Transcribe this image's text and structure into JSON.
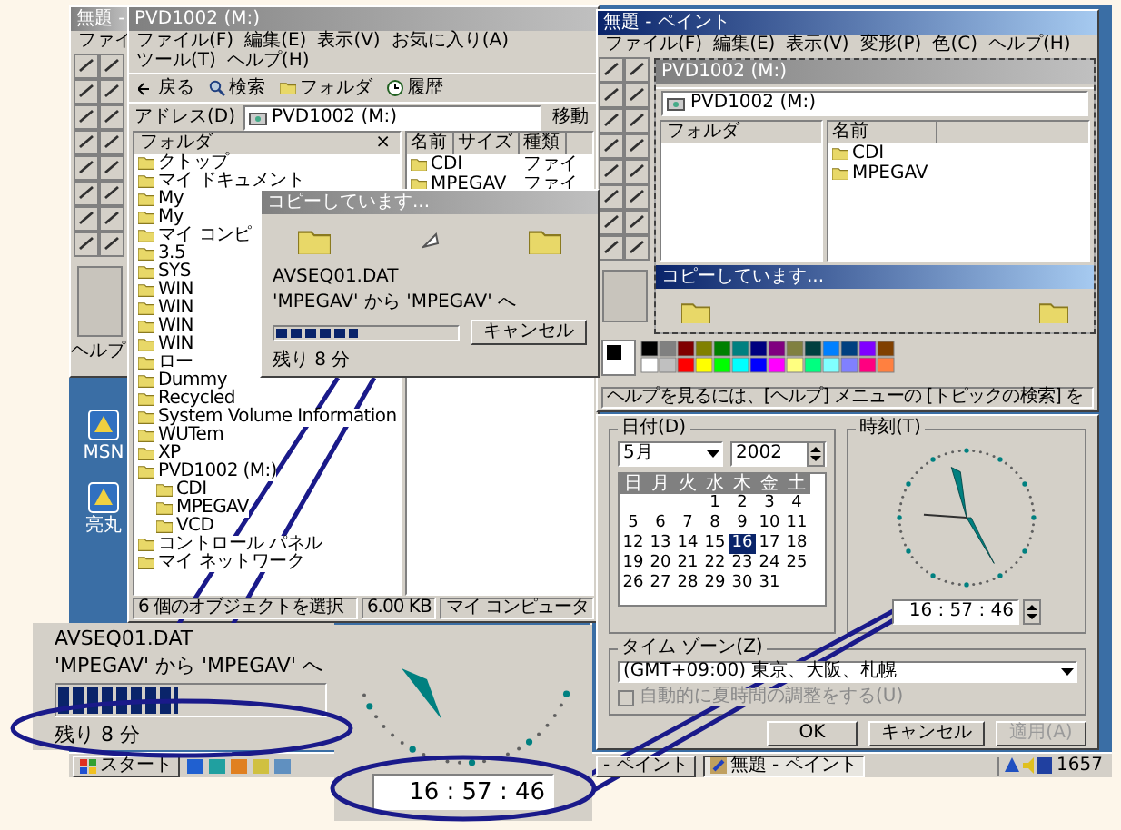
{
  "left_screen": {
    "paint": {
      "title": "無題 -",
      "active": false,
      "menu": "ファイ",
      "status": "ヘルプ"
    },
    "desktop_icons": [
      "MSN",
      "亮丸"
    ],
    "explorer": {
      "title": "PVD1002 (M:)",
      "active": false,
      "menu": [
        "ファイル(F)",
        "編集(E)",
        "表示(V)",
        "お気に入り(A)",
        "ツール(T)",
        "ヘルプ(H)"
      ],
      "toolbar": [
        "戻る",
        "検索",
        "フォルダ",
        "履歴"
      ],
      "address_label": "アドレス(D)",
      "address": "PVD1002 (M:)",
      "go": "移動",
      "folders_title": "フォルダ",
      "folders_close": "×",
      "tree": [
        {
          "label": "クトップ"
        },
        {
          "label": "マイ ドキュメント"
        },
        {
          "label": "My"
        },
        {
          "label": "My"
        },
        {
          "label": "マイ コンピ"
        },
        {
          "label": "3.5"
        },
        {
          "label": "SYS"
        },
        {
          "label": "WIN"
        },
        {
          "label": "WIN"
        },
        {
          "label": "WIN"
        },
        {
          "label": "WIN"
        },
        {
          "label": "ロー"
        },
        {
          "label": "Dummy"
        },
        {
          "label": "Recycled"
        },
        {
          "label": "System Volume Information"
        },
        {
          "label": "WUTem"
        },
        {
          "label": "XP"
        },
        {
          "label": "PVD1002 (M:)",
          "children": [
            {
              "label": "CDI"
            },
            {
              "label": "MPEGAV"
            },
            {
              "label": "VCD"
            }
          ]
        },
        {
          "label": "コントロール パネル"
        },
        {
          "label": "マイ ネットワーク"
        }
      ],
      "columns": [
        "名前",
        "サイズ",
        "種類"
      ],
      "files": [
        {
          "name": "CDI",
          "type": "ファイ"
        },
        {
          "name": "MPEGAV",
          "type": "ファイ"
        }
      ],
      "status": [
        "6 個のオブジェクトを選択",
        "6.00 KB",
        "マイ コンピュータ"
      ]
    },
    "copy_dialog": {
      "title": "コピーしています...",
      "active": false,
      "file": "AVSEQ01.DAT",
      "from_to": "'MPEGAV' から 'MPEGAV' へ",
      "level": 0.45,
      "remaining": "残り 8 分",
      "cancel": "キャンセル"
    },
    "taskbar": {
      "start": "スタート"
    }
  },
  "right_screen": {
    "paint": {
      "title": "無題 - ペイント",
      "active": true,
      "menu": [
        "ファイル(F)",
        "編集(E)",
        "表示(V)",
        "変形(P)",
        "色(C)",
        "ヘルプ(H)"
      ],
      "nested": {
        "title": "PVD1002 (M:)",
        "address": "PVD1002 (M:)",
        "folders_title": "フォルダ",
        "column": "名前",
        "files": [
          "CDI",
          "MPEGAV"
        ],
        "dialog_title": "コピーしています...",
        "dialog_active": true
      },
      "status": "ヘルプを見るには、[ヘルプ] メニューの [トピックの検索] を"
    },
    "datetime": {
      "date_group": "日付(D)",
      "month": "5月",
      "year": "2002",
      "weekdays": [
        "日",
        "月",
        "火",
        "水",
        "木",
        "金",
        "土"
      ],
      "weeks": [
        [
          {
            "d": "1",
            "selected": false
          },
          {
            "d": "2",
            "selected": false
          },
          {
            "d": "3",
            "selected": false
          },
          {
            "d": "4",
            "selected": false
          }
        ],
        [
          {
            "d": "5",
            "selected": false
          },
          {
            "d": "6",
            "selected": false
          },
          {
            "d": "7",
            "selected": false
          },
          {
            "d": "8",
            "selected": false
          },
          {
            "d": "9",
            "selected": false
          },
          {
            "d": "10",
            "selected": false
          },
          {
            "d": "11",
            "selected": false
          }
        ],
        [
          {
            "d": "12",
            "selected": false
          },
          {
            "d": "13",
            "selected": false
          },
          {
            "d": "14",
            "selected": false
          },
          {
            "d": "15",
            "selected": false
          },
          {
            "d": "16",
            "selected": true
          },
          {
            "d": "17",
            "selected": false
          },
          {
            "d": "18",
            "selected": false
          }
        ],
        [
          {
            "d": "19",
            "selected": false
          },
          {
            "d": "20",
            "selected": false
          },
          {
            "d": "21",
            "selected": false
          },
          {
            "d": "22",
            "selected": false
          },
          {
            "d": "23",
            "selected": false
          },
          {
            "d": "24",
            "selected": false
          },
          {
            "d": "25",
            "selected": false
          }
        ],
        [
          {
            "d": "26",
            "selected": false
          },
          {
            "d": "27",
            "selected": false
          },
          {
            "d": "28",
            "selected": false
          },
          {
            "d": "29",
            "selected": false
          },
          {
            "d": "30",
            "selected": false
          },
          {
            "d": "31",
            "selected": false
          }
        ]
      ],
      "time_group": "時刻(T)",
      "time": "16 : 57 : 46",
      "timezone_group": "タイム ゾーン(Z)",
      "timezone": "(GMT+09:00) 東京、大阪、札幌",
      "dst": {
        "label": "自動的に夏時間の調整をする(U)",
        "checked": false,
        "disabled": true
      },
      "buttons": [
        {
          "label": "OK",
          "disabled": false
        },
        {
          "label": "キャンセル",
          "disabled": false
        },
        {
          "label": "適用(A)",
          "disabled": true
        }
      ]
    },
    "taskbar": {
      "fragment": "- ペイント",
      "button": "無題 - ペイント",
      "clock": "1657"
    }
  },
  "zoom_insets": {
    "copy": {
      "file": "AVSEQ01.DAT",
      "from_to": "'MPEGAV' から 'MPEGAV' へ",
      "level": 0.45,
      "remaining": "残り 8 分"
    },
    "clock": {
      "time": "16 : 57 : 46"
    }
  }
}
